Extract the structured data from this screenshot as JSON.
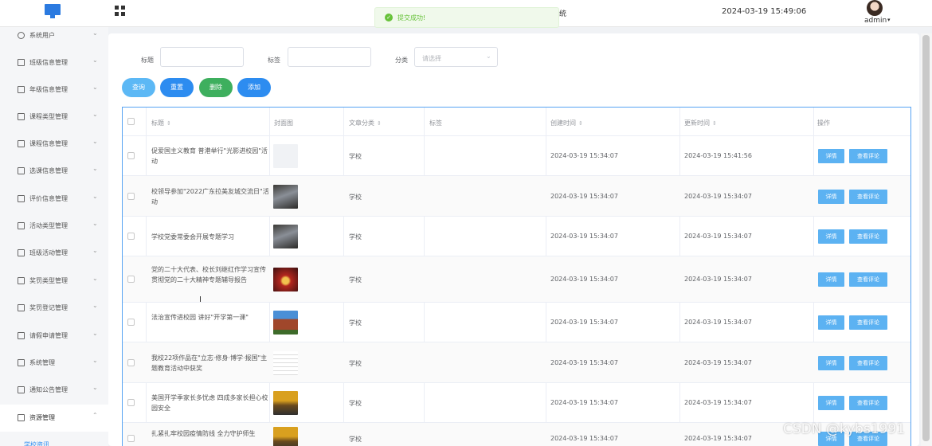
{
  "header": {
    "title_partial": "统",
    "datetime": "2024-03-19 15:49:06",
    "user": "admin",
    "caret": "▾"
  },
  "toast": {
    "message": "提交成功!",
    "icon": "check-circle-icon",
    "color": "#67c23a"
  },
  "sidebar": {
    "items": [
      {
        "label": "系统用户",
        "icon": "user-icon"
      },
      {
        "label": "班级信息管理",
        "icon": "menu-icon"
      },
      {
        "label": "年级信息管理",
        "icon": "menu-icon"
      },
      {
        "label": "课程类型管理",
        "icon": "menu-icon"
      },
      {
        "label": "课程信息管理",
        "icon": "menu-icon"
      },
      {
        "label": "选课信息管理",
        "icon": "menu-icon"
      },
      {
        "label": "评价信息管理",
        "icon": "menu-icon"
      },
      {
        "label": "活动类型管理",
        "icon": "menu-icon"
      },
      {
        "label": "班级活动管理",
        "icon": "menu-icon"
      },
      {
        "label": "奖罚类型管理",
        "icon": "menu-icon"
      },
      {
        "label": "奖罚登记管理",
        "icon": "menu-icon"
      },
      {
        "label": "请假申请管理",
        "icon": "menu-icon"
      },
      {
        "label": "系统管理",
        "icon": "menu-icon"
      },
      {
        "label": "通知公告管理",
        "icon": "menu-icon"
      },
      {
        "label": "资源管理",
        "icon": "resource-icon"
      }
    ],
    "chevron": "⌄",
    "active_chevron": "⌃",
    "sub_item": "学校资讯"
  },
  "filters": {
    "title_label": "标题",
    "tag_label": "标签",
    "category_label": "分类",
    "category_placeholder": "请选择",
    "title_value": "",
    "tag_value": ""
  },
  "buttons": {
    "query": "查询",
    "reset": "重置",
    "delete": "删除",
    "add": "添加"
  },
  "colors": {
    "query": "#5cb8f5",
    "reset": "#2d8cf0",
    "delete": "#3eaf5e",
    "add": "#2d8cf0",
    "table_border": "#57a3f3"
  },
  "table": {
    "columns": [
      "标题",
      "封面图",
      "文章分类",
      "标签",
      "创建时间",
      "更新时间",
      "操作"
    ],
    "sort_icon": "⇕",
    "detail_label": "详情",
    "comment_label": "查看评论",
    "rows": [
      {
        "title": "促爱国主义教育 普港举行\"光影进校园\"活动",
        "category": "学校",
        "tag": "",
        "created": "2024-03-19 15:34:07",
        "updated": "2024-03-19 15:41:56",
        "cover": "blank-cover"
      },
      {
        "title": "校领导参加\"2022广东拉美友城交流日\"活动",
        "category": "学校",
        "tag": "",
        "created": "2024-03-19 15:34:07",
        "updated": "2024-03-19 15:34:07",
        "cover": "meeting-photo"
      },
      {
        "title": "学校党委常委会开展专题学习",
        "category": "学校",
        "tag": "",
        "created": "2024-03-19 15:34:07",
        "updated": "2024-03-19 15:34:07",
        "cover": "meeting-photo"
      },
      {
        "title": "党的二十大代表、校长刘继红作学习宣传贯彻党的二十大精神专题辅导报告",
        "category": "学校",
        "tag": "",
        "created": "2024-03-19 15:34:07",
        "updated": "2024-03-19 15:34:07",
        "cover": "stage-photo"
      },
      {
        "title": "法治宣传进校园 讲好\"开学第一课\"",
        "category": "学校",
        "tag": "",
        "created": "2024-03-19 15:34:07",
        "updated": "2024-03-19 15:34:07",
        "cover": "building-photo"
      },
      {
        "title": "我校22项作品在\"立志·修身·博学·报国\"主题教育活动中获奖",
        "category": "学校",
        "tag": "",
        "created": "2024-03-19 15:34:07",
        "updated": "2024-03-19 15:34:07",
        "cover": "document-photo"
      },
      {
        "title": "美国开学季家长多忧虑 四成多家长担心校园安全",
        "category": "学校",
        "tag": "",
        "created": "2024-03-19 15:34:07",
        "updated": "2024-03-19 15:34:07",
        "cover": "tree-photo"
      },
      {
        "title": "扎紧扎牢校园疫情防线 全力守护师生",
        "category": "学校",
        "tag": "",
        "created": "2024-03-19 15:34:07",
        "updated": "2024-03-19 15:34:07",
        "cover": "tree-photo"
      }
    ]
  },
  "watermark": "CSDN @kybs1991"
}
